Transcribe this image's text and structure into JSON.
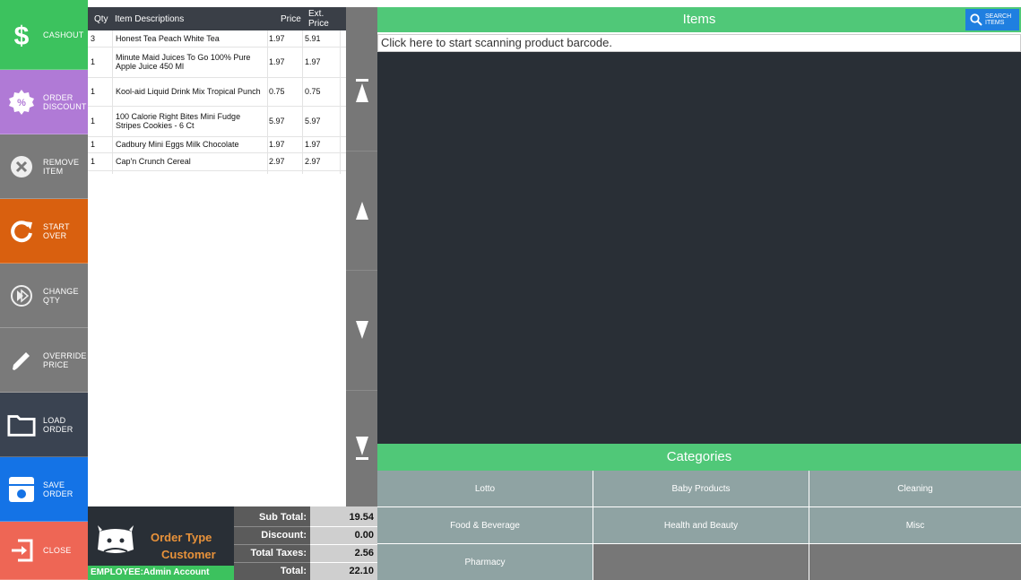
{
  "actions": [
    {
      "label": "CASHOUT",
      "icon": "dollar-icon",
      "color": "#3cc25e"
    },
    {
      "label": "ORDER\nDISCOUNT",
      "icon": "percent-badge-icon",
      "color": "#b07ad6"
    },
    {
      "label": "REMOVE\nITEM",
      "icon": "remove-circle-icon",
      "color": "#7a7a7a"
    },
    {
      "label": "START\nOVER",
      "icon": "refresh-icon",
      "color": "#d9600f"
    },
    {
      "label": "CHANGE\nQTY",
      "icon": "change-qty-icon",
      "color": "#7a7a7a"
    },
    {
      "label": "OVERRIDE\nPRICE",
      "icon": "pencil-icon",
      "color": "#7a7a7a"
    },
    {
      "label": "LOAD\nORDER",
      "icon": "folder-icon",
      "color": "#3a4351"
    },
    {
      "label": "SAVE\nORDER",
      "icon": "save-icon",
      "color": "#1473e6"
    },
    {
      "label": "CLOSE",
      "icon": "exit-icon",
      "color": "#ee6655"
    }
  ],
  "grid": {
    "headers": {
      "qty": "Qty",
      "desc": "Item Descriptions",
      "price": "Price",
      "ext": "Ext. Price"
    },
    "rows": [
      {
        "qty": "3",
        "desc": "Honest Tea Peach White Tea",
        "price": "1.97",
        "ext": "5.91"
      },
      {
        "qty": "1",
        "desc": "Minute Maid Juices To Go 100% Pure Apple Juice 450 Ml",
        "price": "1.97",
        "ext": "1.97"
      },
      {
        "qty": "1",
        "desc": "Kool-aid Liquid Drink Mix Tropical Punch",
        "price": "0.75",
        "ext": "0.75"
      },
      {
        "qty": "1",
        "desc": "100 Calorie Right Bites Mini Fudge Stripes Cookies - 6 Ct",
        "price": "5.97",
        "ext": "5.97"
      },
      {
        "qty": "1",
        "desc": "Cadbury Mini Eggs Milk Chocolate",
        "price": "1.97",
        "ext": "1.97"
      },
      {
        "qty": "1",
        "desc": "Cap'n Crunch Cereal",
        "price": "2.97",
        "ext": "2.97"
      }
    ]
  },
  "scroll_icons": [
    "scroll-top-icon",
    "scroll-up-icon",
    "scroll-down-icon",
    "scroll-bottom-icon"
  ],
  "order": {
    "type_label": "Order Type",
    "type_value": "Customer",
    "employee": "EMPLOYEE:Admin Account",
    "accent": "#e8923a"
  },
  "totals": [
    {
      "label": "Sub Total:",
      "value": "19.54"
    },
    {
      "label": "Discount:",
      "value": "0.00"
    },
    {
      "label": "Total Taxes:",
      "value": "2.56"
    },
    {
      "label": "Total:",
      "value": "22.10"
    }
  ],
  "items": {
    "title": "Items",
    "search_label": "SEARCH\nITEMS",
    "scan_placeholder": "Click here to start scanning product barcode."
  },
  "categories": {
    "title": "Categories",
    "list": [
      "Lotto",
      "Baby Products",
      "Cleaning",
      "Food & Beverage",
      "Health and Beauty",
      "Misc",
      "Pharmacy",
      "",
      ""
    ]
  }
}
